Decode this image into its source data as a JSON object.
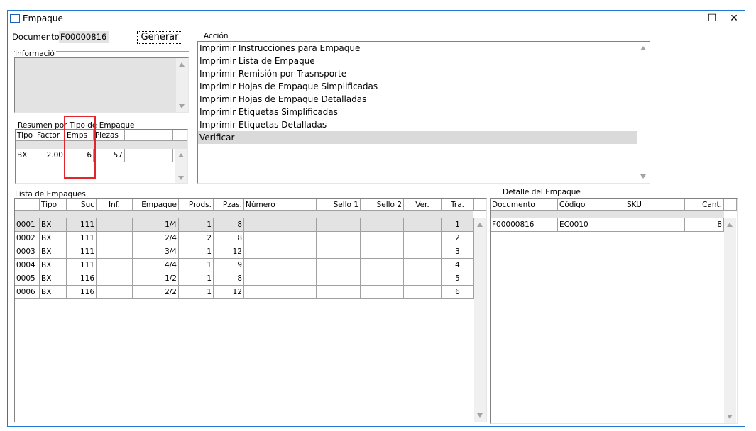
{
  "window": {
    "title": "Empaque",
    "minimize_glyph": "☐",
    "close_glyph": "✕"
  },
  "documento": {
    "label": "Documento:",
    "value": "F00000816"
  },
  "generar": {
    "label": "Generar"
  },
  "informacion": {
    "label": "Informació"
  },
  "accion": {
    "label": "Acción",
    "items": [
      "Imprimir Instrucciones para Empaque",
      "Imprimir Lista de Empaque",
      "Imprimir Remisión por Trasnsporte",
      "Imprimir Hojas de Empaque Simplificadas",
      "Imprimir Hojas de Empaque Detalladas",
      "Imprimir Etiquetas Simplificadas",
      "Imprimir Etiquetas Detalladas",
      "Verificar"
    ],
    "selected": 7
  },
  "resumen": {
    "label": "Resumen por Tipo de Empaque",
    "headers": [
      "Tipo",
      "Factor",
      "Emps",
      "Piezas"
    ],
    "rows": [
      [
        "BX",
        "2.00",
        "6",
        "57"
      ]
    ]
  },
  "lista": {
    "label": "Lista de Empaques",
    "headers": [
      "Tipo",
      "Suc",
      "Inf.",
      "Empaque",
      "Prods.",
      "Pzas.",
      "Número",
      "Sello 1",
      "Sello 2",
      "Ver.",
      "Tra."
    ],
    "rows": [
      [
        "0001",
        "BX",
        "111",
        "",
        "1/4",
        "1",
        "8",
        "",
        "",
        "",
        "",
        "1"
      ],
      [
        "0002",
        "BX",
        "111",
        "",
        "2/4",
        "2",
        "8",
        "",
        "",
        "",
        "",
        "2"
      ],
      [
        "0003",
        "BX",
        "111",
        "",
        "3/4",
        "1",
        "12",
        "",
        "",
        "",
        "",
        "3"
      ],
      [
        "0004",
        "BX",
        "111",
        "",
        "4/4",
        "1",
        "9",
        "",
        "",
        "",
        "",
        "4"
      ],
      [
        "0005",
        "BX",
        "116",
        "",
        "1/2",
        "1",
        "8",
        "",
        "",
        "",
        "",
        "5"
      ],
      [
        "0006",
        "BX",
        "116",
        "",
        "2/2",
        "1",
        "12",
        "",
        "",
        "",
        "",
        "6"
      ]
    ]
  },
  "detalle": {
    "label": "Detalle del Empaque",
    "headers": [
      "Documento",
      "Código",
      "SKU",
      "Cant."
    ],
    "rows": [
      [
        "F00000816",
        "EC0010",
        "",
        "8"
      ]
    ]
  },
  "colors": {
    "window_border": "#1e78d2",
    "highlight_box": "#e0262a",
    "selection": "#e3e3e3"
  }
}
